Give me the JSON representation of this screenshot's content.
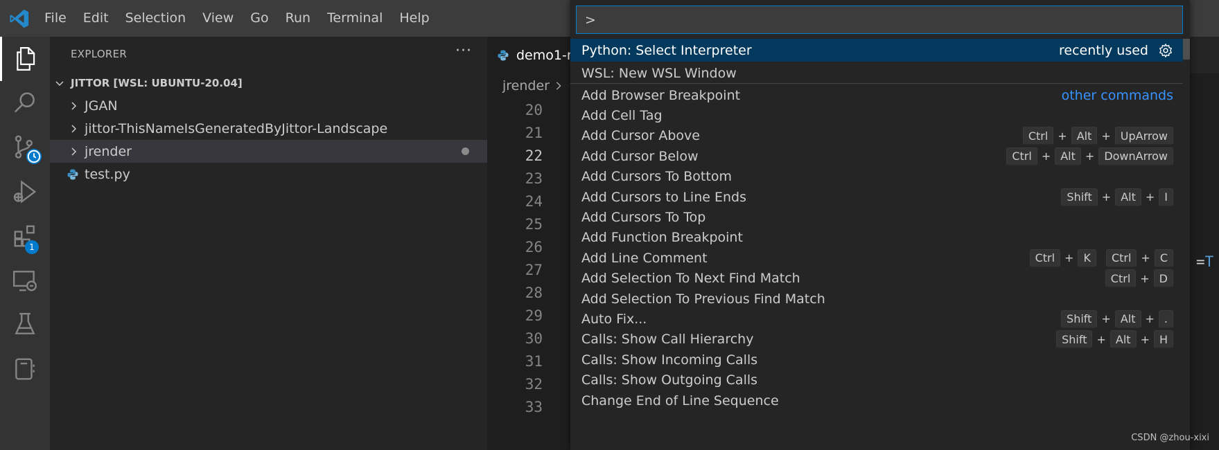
{
  "menu": [
    "File",
    "Edit",
    "Selection",
    "View",
    "Go",
    "Run",
    "Terminal",
    "Help"
  ],
  "activity": {
    "extensions_badge": "1"
  },
  "sidebar": {
    "title": "EXPLORER",
    "more": "···",
    "root": "JITTOR [WSL: UBUNTU-20.04]",
    "items": [
      {
        "label": "JGAN",
        "type": "folder"
      },
      {
        "label": "jittor-ThisNameIsGeneratedByJittor-Landscape",
        "type": "folder"
      },
      {
        "label": "jrender",
        "type": "folder",
        "modified": true
      },
      {
        "label": "test.py",
        "type": "python-file"
      }
    ]
  },
  "editor": {
    "tab_label": "demo1-re",
    "breadcrumb": "jrender",
    "line_numbers": [
      "20",
      "21",
      "22",
      "23",
      "24",
      "25",
      "26",
      "27",
      "28",
      "29",
      "30",
      "31",
      "32",
      "33"
    ],
    "current_line": "22",
    "code_fragment_op": "=",
    "code_fragment_kw": "T"
  },
  "quickpick": {
    "input_value": ">",
    "recent": [
      {
        "label": "Python: Select Interpreter",
        "desc": "recently used",
        "gear": true
      },
      {
        "label": "WSL: New WSL Window"
      }
    ],
    "other_label": "other commands",
    "commands": [
      {
        "label": "Add Browser Breakpoint",
        "keys": []
      },
      {
        "label": "Add Cell Tag",
        "keys": []
      },
      {
        "label": "Add Cursor Above",
        "keys": [
          [
            "Ctrl",
            "Alt",
            "UpArrow"
          ]
        ]
      },
      {
        "label": "Add Cursor Below",
        "keys": [
          [
            "Ctrl",
            "Alt",
            "DownArrow"
          ]
        ]
      },
      {
        "label": "Add Cursors To Bottom",
        "keys": []
      },
      {
        "label": "Add Cursors to Line Ends",
        "keys": [
          [
            "Shift",
            "Alt",
            "I"
          ]
        ]
      },
      {
        "label": "Add Cursors To Top",
        "keys": []
      },
      {
        "label": "Add Function Breakpoint",
        "keys": []
      },
      {
        "label": "Add Line Comment",
        "keys": [
          [
            "Ctrl",
            "K"
          ],
          [
            "Ctrl",
            "C"
          ]
        ]
      },
      {
        "label": "Add Selection To Next Find Match",
        "keys": [
          [
            "Ctrl",
            "D"
          ]
        ]
      },
      {
        "label": "Add Selection To Previous Find Match",
        "keys": []
      },
      {
        "label": "Auto Fix...",
        "keys": [
          [
            "Shift",
            "Alt",
            "."
          ]
        ]
      },
      {
        "label": "Calls: Show Call Hierarchy",
        "keys": [
          [
            "Shift",
            "Alt",
            "H"
          ]
        ]
      },
      {
        "label": "Calls: Show Incoming Calls",
        "keys": []
      },
      {
        "label": "Calls: Show Outgoing Calls",
        "keys": []
      },
      {
        "label": "Change End of Line Sequence",
        "keys": []
      }
    ]
  },
  "watermark": "CSDN @zhou-xixi",
  "colors": {
    "accent": "#007acc",
    "focus_row": "#04395e",
    "link": "#3794ff"
  }
}
